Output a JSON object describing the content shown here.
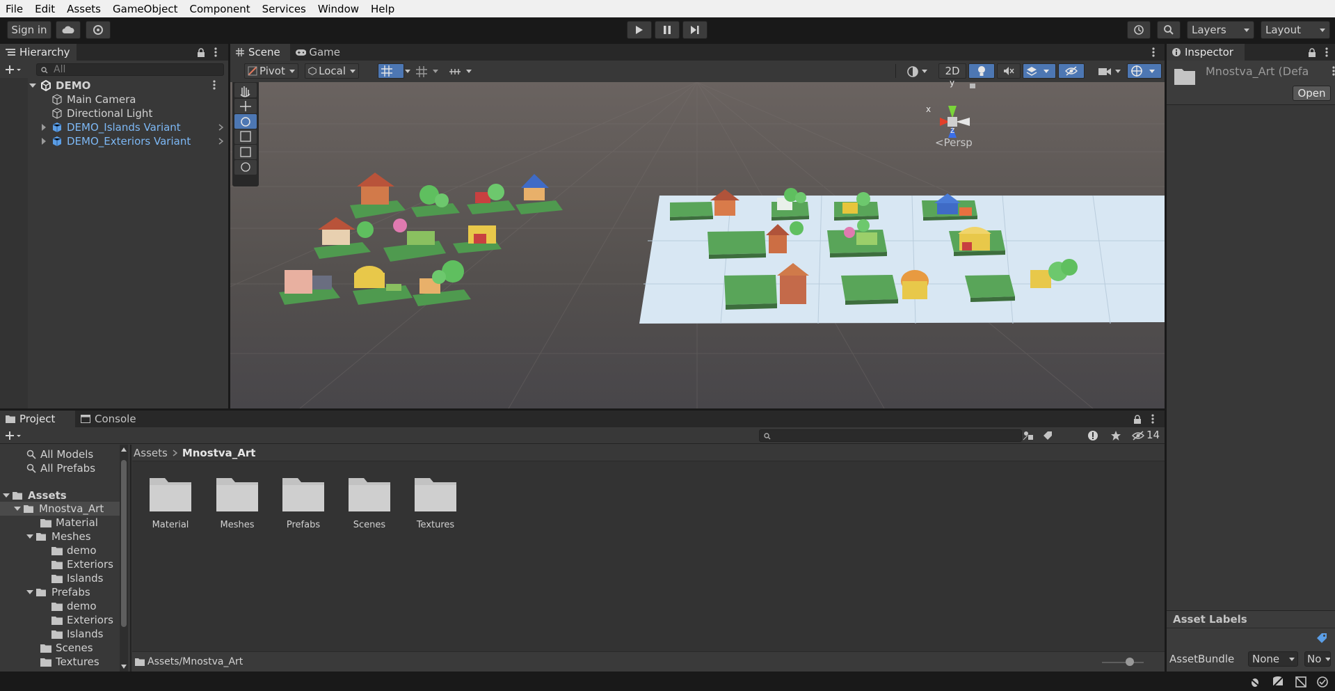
{
  "menu": [
    "File",
    "Edit",
    "Assets",
    "GameObject",
    "Component",
    "Services",
    "Window",
    "Help"
  ],
  "toolbar": {
    "sign_in": "Sign in",
    "layers": "Layers",
    "layout": "Layout"
  },
  "hierarchy": {
    "tab": "Hierarchy",
    "search_placeholder": "All",
    "scene": "DEMO",
    "items": [
      {
        "label": "Main Camera",
        "prefab": false
      },
      {
        "label": "Directional Light",
        "prefab": false
      },
      {
        "label": "DEMO_Islands Variant",
        "prefab": true
      },
      {
        "label": "DEMO_Exteriors Variant",
        "prefab": true
      }
    ]
  },
  "scene": {
    "tabs": [
      "Scene",
      "Game"
    ],
    "pivot": "Pivot",
    "local": "Local",
    "mode_2d": "2D",
    "gizmo_persp": "Persp",
    "axis_x": "x",
    "axis_y": "y",
    "axis_z": "z"
  },
  "inspector": {
    "tab": "Inspector",
    "title": "Mnostva_Art (Defa",
    "open": "Open",
    "asset_labels": "Asset Labels",
    "asset_bundle": "AssetBundle",
    "bundle_value": "None",
    "variant_value": "No"
  },
  "project": {
    "tabs": [
      "Project",
      "Console"
    ],
    "hidden_count": "14",
    "favorites": [
      "All Models",
      "All Prefabs"
    ],
    "tree": {
      "root": "Assets",
      "mnostva": "Mnostva_Art",
      "material": "Material",
      "meshes": "Meshes",
      "meshes_children": [
        "demo",
        "Exteriors",
        "Islands"
      ],
      "prefabs": "Prefabs",
      "prefabs_children": [
        "demo",
        "Exteriors",
        "Islands"
      ],
      "scenes": "Scenes",
      "textures": "Textures"
    },
    "breadcrumb": [
      "Assets",
      "Mnostva_Art"
    ],
    "folders": [
      "Material",
      "Meshes",
      "Prefabs",
      "Scenes",
      "Textures"
    ],
    "footer_path": "Assets/Mnostva_Art"
  },
  "colors": {
    "accent": "#4d77b3",
    "panel": "#383838",
    "grass": "#4f9a4f"
  }
}
